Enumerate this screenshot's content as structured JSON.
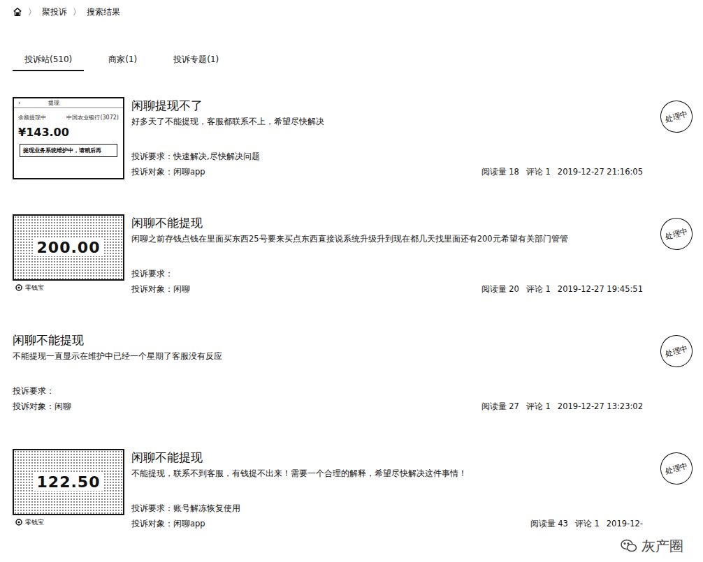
{
  "breadcrumb": {
    "separator": "〉",
    "items": [
      "聚投诉",
      "搜索结果"
    ]
  },
  "tabs": [
    {
      "label": "投诉站(510)",
      "selected": true
    },
    {
      "label": "商家(1)",
      "selected": false
    },
    {
      "label": "投诉专题(1)",
      "selected": false
    }
  ],
  "complaints": [
    {
      "title": "闲聊提现不了",
      "description": "好多天了不能提现，客服都联系不上，希望尽快解决",
      "requirementLabel": "投诉要求：",
      "requirement": "快速解决,尽快解决问题",
      "targetLabel": "投诉对象：",
      "target": "闲聊app",
      "readsLabel": "阅读量",
      "reads": "18",
      "commentsLabel": "评论",
      "comments": "1",
      "time": "2019-12-27 21:16:05",
      "status": "处理中",
      "thumbnail": {
        "kind": "screen",
        "header": "提现",
        "back": "‹",
        "lines": [
          "余额提现中",
          "中国农业银行(3072)"
        ],
        "amount": "¥143.00",
        "notice": "提现业务系统维护中，请稍后再"
      }
    },
    {
      "title": "闲聊不能提现",
      "description": "闲聊之前存钱点钱在里面买东西25号要来买点东西直接说系统升级升到现在都几天找里面还有200元希望有关部门管管",
      "requirementLabel": "投诉要求：",
      "requirement": "",
      "targetLabel": "投诉对象：",
      "target": "闲聊",
      "readsLabel": "阅读量",
      "reads": "20",
      "commentsLabel": "评论",
      "comments": "1",
      "time": "2019-12-27 19:45:51",
      "status": "处理中",
      "thumbnail": {
        "kind": "balance",
        "amount": "200.00",
        "caption": "零钱宝"
      }
    },
    {
      "title": "闲聊不能提现",
      "description": "不能提现一直显示在维护中已经一个星期了客服没有反应",
      "requirementLabel": "投诉要求：",
      "requirement": "",
      "targetLabel": "投诉对象：",
      "target": "闲聊",
      "readsLabel": "阅读量",
      "reads": "27",
      "commentsLabel": "评论",
      "comments": "1",
      "time": "2019-12-27 13:23:02",
      "status": "处理中",
      "thumbnail": null
    },
    {
      "title": "闲聊不能提现",
      "description": "不能提现，联系不到客服，有钱提不出来！需要一个合理的解释，希望尽快解决这件事情！",
      "requirementLabel": "投诉要求：",
      "requirement": "账号解冻恢复使用",
      "targetLabel": "投诉对象：",
      "target": "闲聊app",
      "readsLabel": "阅读量",
      "reads": "43",
      "commentsLabel": "评论",
      "comments": "1",
      "time": "2019-12-",
      "status": "处理中",
      "thumbnail": {
        "kind": "balance",
        "amount": "122.50",
        "caption": "零钱宝"
      }
    }
  ],
  "watermark": "灰产圈"
}
